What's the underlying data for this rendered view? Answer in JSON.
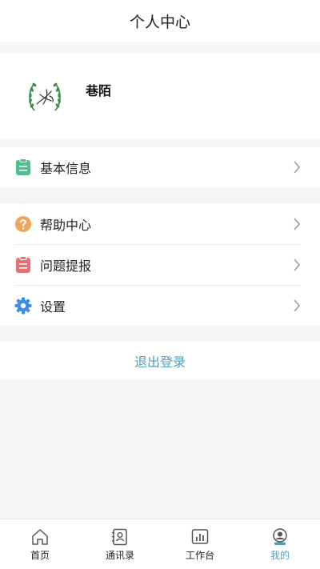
{
  "header": {
    "title": "个人中心"
  },
  "profile": {
    "username": "巷陌"
  },
  "menu": {
    "basic_info": "基本信息",
    "help_center": "帮助中心",
    "report_issue": "问题提报",
    "settings": "设置"
  },
  "logout_label": "退出登录",
  "tabs": [
    {
      "label": "首页",
      "icon": "home-icon"
    },
    {
      "label": "通讯录",
      "icon": "contacts-icon"
    },
    {
      "label": "工作台",
      "icon": "workbench-icon"
    },
    {
      "label": "我的",
      "icon": "profile-icon",
      "active": true
    }
  ],
  "colors": {
    "accent": "#4d9fc1",
    "green": "#4cc28a",
    "orange": "#f0a55d",
    "red": "#e77070",
    "blue": "#3a8ee6"
  }
}
